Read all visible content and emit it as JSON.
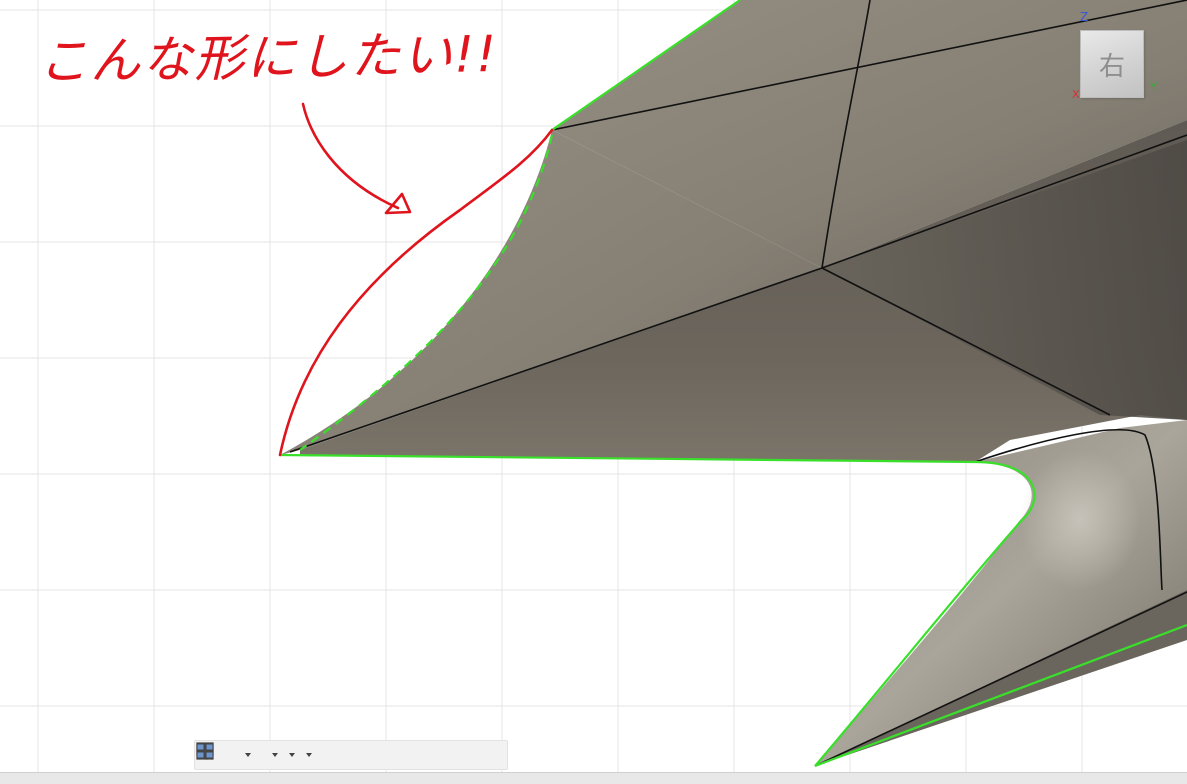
{
  "annotation": {
    "text": "こんな形にしたい!!",
    "color": "#e0141c"
  },
  "viewcube": {
    "face_label": "右",
    "axis_z": "Z",
    "axis_y": "Y",
    "axis_x": "X"
  },
  "colors": {
    "model_surface": "#7e786d",
    "model_dark": "#4f4b46",
    "edge_highlight": "#39e02a",
    "grid": "#e4e4e4",
    "sketch_red": "#e0141c"
  },
  "toolbar": {
    "icons": [
      {
        "name": "orbit-icon",
        "dropdown": true
      },
      {
        "name": "look-at-icon",
        "dropdown": false
      },
      {
        "name": "pan-icon",
        "dropdown": false
      },
      {
        "name": "zoom-icon",
        "dropdown": false
      },
      {
        "name": "fit-icon",
        "dropdown": true
      },
      {
        "name": "display-settings-icon",
        "dropdown": true
      },
      {
        "name": "grid-icon",
        "dropdown": true
      },
      {
        "name": "viewports-icon",
        "dropdown": true
      }
    ]
  }
}
